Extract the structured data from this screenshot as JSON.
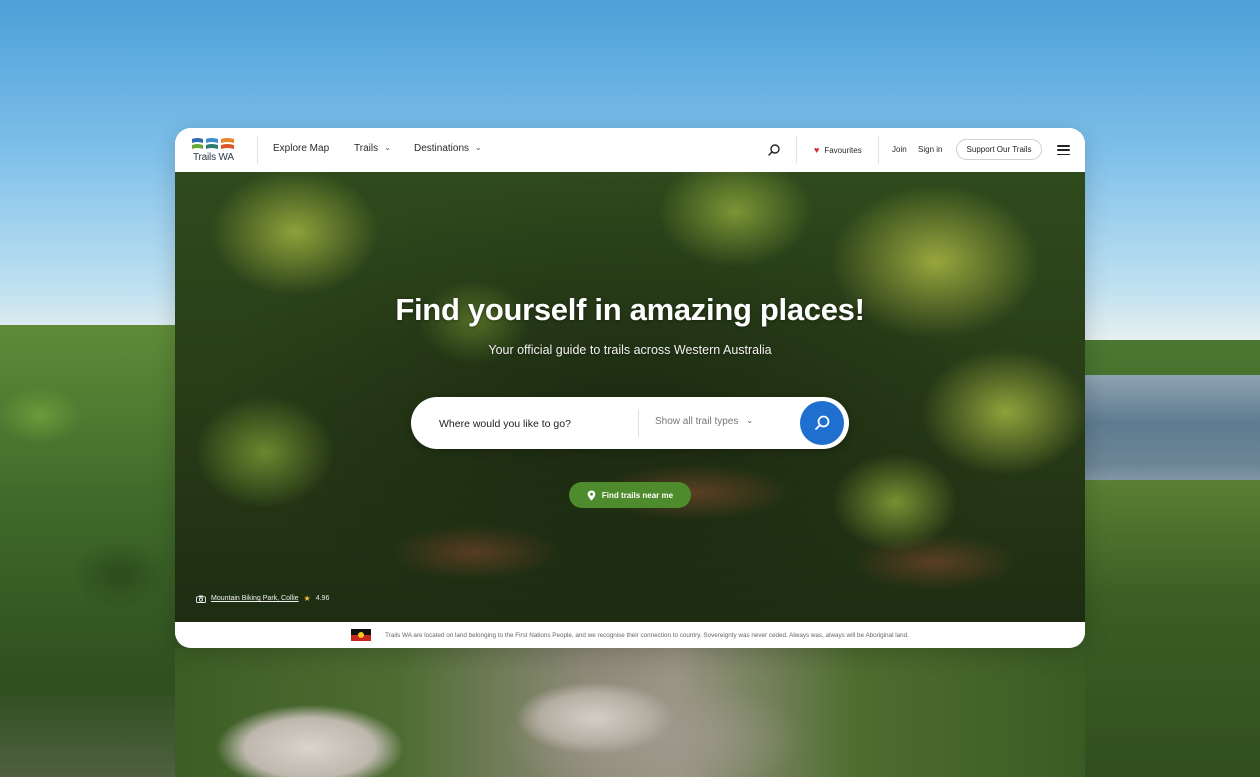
{
  "nav": {
    "logo_text": "Trails WA",
    "links": [
      {
        "label": "Explore Map"
      },
      {
        "label": "Trails"
      },
      {
        "label": "Destinations"
      }
    ],
    "favourites_label": "Favourites",
    "join_label": "Join",
    "signin_label": "Sign in",
    "support_label": "Support Our Trails",
    "icons": {
      "search": "search-icon",
      "menu": "hamburger-menu-icon",
      "heart": "heart-icon"
    }
  },
  "hero": {
    "title": "Find yourself in amazing places!",
    "subtitle": "Your official guide to trails across Western Australia",
    "search_placeholder": "Where would you like to go?",
    "trail_type_label": "Show all trail types",
    "near_me_label": "Find trails near me",
    "photo_credit": {
      "location": "Mountain Biking Park, Collie",
      "rating": "4.96"
    }
  },
  "acknowledgement": {
    "text": "Trails WA are located on land belonging to the First Nations People, and we recognise their connection to country. Sovereignty was never ceded. Always was, always will be Aboriginal land."
  },
  "colors": {
    "accent_blue": "#1f6fd0",
    "accent_green": "#4e8b2c",
    "heart_red": "#d42b2b",
    "star_gold": "#f2c230"
  }
}
